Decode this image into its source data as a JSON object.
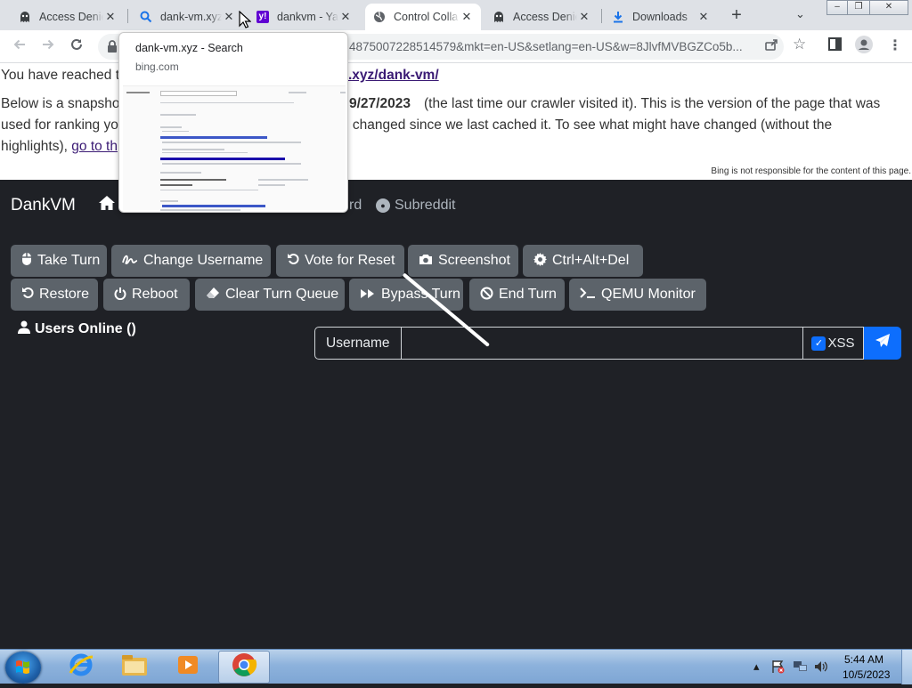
{
  "browser": {
    "tabs": [
      {
        "title": "Access Denie",
        "icon": "ghost-icon",
        "active": false
      },
      {
        "title": "dank-vm.xyz",
        "icon": "search-icon",
        "active": false
      },
      {
        "title": "dankvm - Ya",
        "icon": "yahoo-icon",
        "active": false
      },
      {
        "title": "Control Colla",
        "icon": "globe-icon",
        "active": true
      },
      {
        "title": "Access Denie",
        "icon": "ghost-icon",
        "active": false
      },
      {
        "title": "Downloads",
        "icon": "download-icon",
        "active": false
      }
    ],
    "new_tab_label": "+",
    "url_visible": "4875007228514579&mkt=en-US&setlang=en-US&w=8JlvfMVBGZCo5b..."
  },
  "hover_preview": {
    "title": "dank-vm.xyz - Search",
    "domain": "bing.com"
  },
  "cache_banner": {
    "line1_start": "You have reached t",
    "cached_url_fragment": ".xyz/dank-vm/",
    "line2_start": "Below is a snapsho",
    "date": "9/27/2023",
    "line2_end": "(the last time our crawler visited it). This is the version of the page that was",
    "line3_start": "used for ranking yo",
    "line3_end": "e changed since we last cached it. To see what might have changed (without the",
    "line4_start": "highlights),",
    "line4_link": "go to th",
    "disclaimer": "Bing is not responsible for the content of this page."
  },
  "app": {
    "brand": "DankVM",
    "nav_fragment": "rd",
    "nav_subreddit": "Subreddit",
    "buttons_row1": [
      {
        "label": "Take Turn",
        "icon": "mouse-icon"
      },
      {
        "label": "Change Username",
        "icon": "signature-icon"
      },
      {
        "label": "Vote for Reset",
        "icon": "undo-icon"
      },
      {
        "label": "Screenshot",
        "icon": "camera-icon"
      },
      {
        "label": "Ctrl+Alt+Del",
        "icon": "gear-icon"
      }
    ],
    "buttons_row2": [
      {
        "label": "Restore",
        "icon": "undo-icon"
      },
      {
        "label": "Reboot",
        "icon": "power-icon"
      },
      {
        "label": "Clear Turn Queue",
        "icon": "eraser-icon"
      },
      {
        "label": "Bypass Turn",
        "icon": "forward-icon"
      },
      {
        "label": "End Turn",
        "icon": "ban-icon"
      },
      {
        "label": "QEMU Monitor",
        "icon": "terminal-icon"
      }
    ],
    "users_online": "Users Online ()",
    "chat": {
      "username_label": "Username",
      "input_value": "",
      "xss_label": "XSS",
      "xss_checked": true
    }
  },
  "taskbar": {
    "time": "5:44 AM",
    "date": "10/5/2023"
  }
}
